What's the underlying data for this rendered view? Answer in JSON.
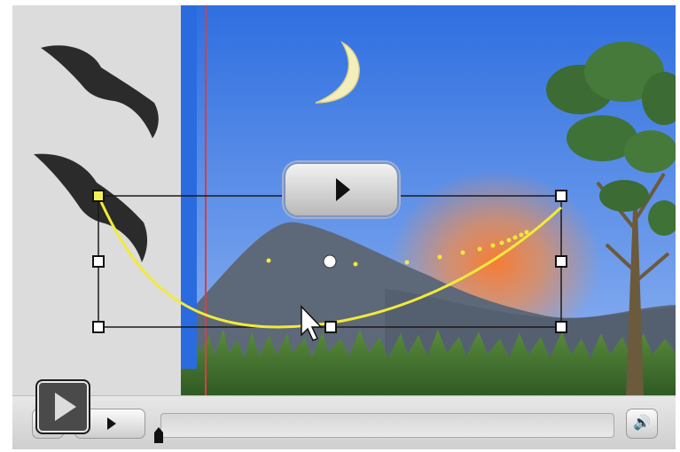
{
  "stage": {
    "description_icons": [
      "bird-silhouette-icon",
      "crescent-moon-icon",
      "tree-icon",
      "grass-icon"
    ],
    "colors": {
      "sky_top": "#2f6fe0",
      "sky_bottom": "#8fb3f0",
      "mountain": "#5d6878",
      "sun_glow": "#ff7a2a",
      "motion_path": "#f2ea3a",
      "grass": "#4e8a3a",
      "timeline_marker": "#d64040"
    }
  },
  "overlay": {
    "play_icon": "play-icon"
  },
  "controls": {
    "big_play_icon": "play-icon",
    "mini_play_icon": "play-icon",
    "volume_icon": "speaker-icon",
    "scrub_icon": "playhead-icon"
  }
}
